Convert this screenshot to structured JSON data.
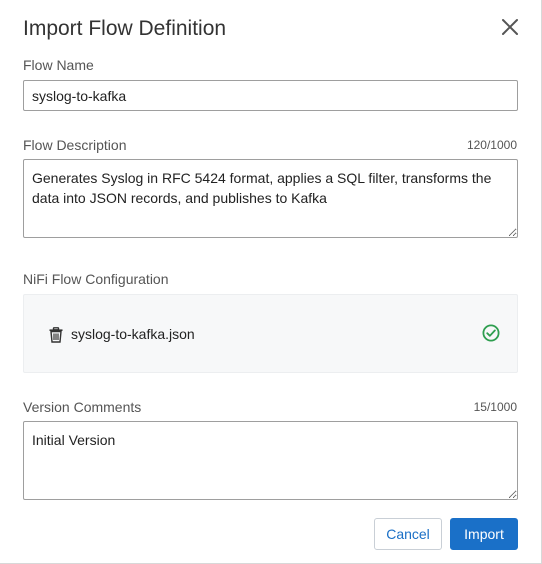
{
  "dialog": {
    "title": "Import Flow Definition",
    "close_icon": "close-icon"
  },
  "flow_name": {
    "label": "Flow Name",
    "value": "syslog-to-kafka"
  },
  "flow_description": {
    "label": "Flow Description",
    "counter": "120/1000",
    "value": "Generates Syslog in RFC 5424 format, applies a SQL filter, transforms the data into JSON records, and publishes to Kafka"
  },
  "nifi_config": {
    "label": "NiFi Flow Configuration",
    "file_name": "syslog-to-kafka.json",
    "delete_icon": "trash-icon",
    "status_icon": "check-circle-icon"
  },
  "version_comments": {
    "label": "Version Comments",
    "counter": "15/1000",
    "value": "Initial Version"
  },
  "actions": {
    "cancel_label": "Cancel",
    "import_label": "Import"
  },
  "colors": {
    "primary": "#1a70c8",
    "success": "#2e9e4f"
  }
}
